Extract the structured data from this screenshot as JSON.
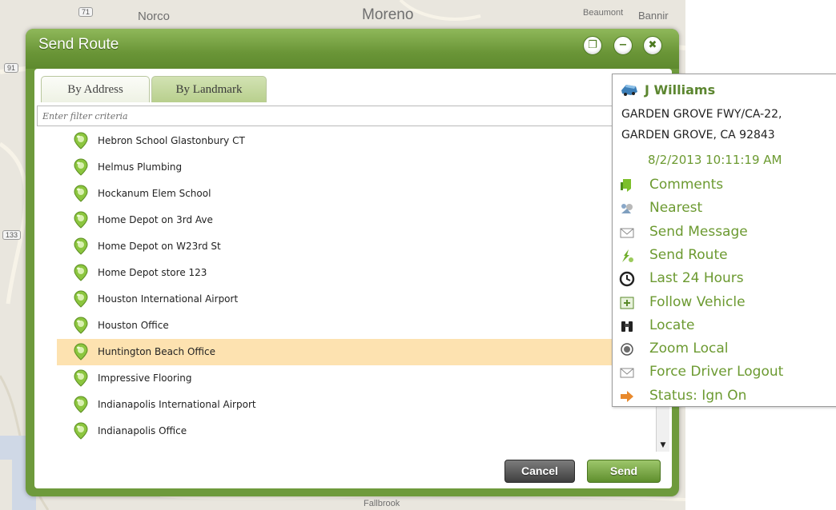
{
  "map": {
    "labels": [
      "Norco",
      "Moreno",
      "Beaumont",
      "Bannir",
      "Fallbrook"
    ],
    "shields": [
      "71",
      "91",
      "133"
    ]
  },
  "dialog": {
    "title": "Send Route",
    "tabs": [
      {
        "label": "By Address",
        "active": false
      },
      {
        "label": "By Landmark",
        "active": true
      }
    ],
    "filter": {
      "placeholder": "Enter filter criteria",
      "value": ""
    },
    "landmarks": [
      {
        "label": "Hebron School Glastonbury CT",
        "selected": false
      },
      {
        "label": "Helmus Plumbing",
        "selected": false
      },
      {
        "label": "Hockanum Elem School",
        "selected": false
      },
      {
        "label": "Home Depot on 3rd Ave",
        "selected": false
      },
      {
        "label": "Home Depot on W23rd St",
        "selected": false
      },
      {
        "label": "Home Depot store 123",
        "selected": false
      },
      {
        "label": "Houston International Airport",
        "selected": false
      },
      {
        "label": "Houston Office",
        "selected": false
      },
      {
        "label": "Huntington Beach Office",
        "selected": true
      },
      {
        "label": "Impressive Flooring",
        "selected": false
      },
      {
        "label": "Indianapolis International Airport",
        "selected": false
      },
      {
        "label": "Indianapolis Office",
        "selected": false
      }
    ],
    "buttons": {
      "cancel": "Cancel",
      "send": "Send"
    }
  },
  "popup": {
    "driver": "J Williams",
    "address_line1": "GARDEN GROVE FWY/CA-22,",
    "address_line2": "GARDEN GROVE, CA 92843",
    "timestamp": "8/2/2013 10:11:19 AM",
    "menu": [
      {
        "label": "Comments",
        "icon": "comments-icon"
      },
      {
        "label": "Nearest",
        "icon": "nearest-icon"
      },
      {
        "label": "Send Message",
        "icon": "envelope-icon"
      },
      {
        "label": "Send Route",
        "icon": "route-icon"
      },
      {
        "label": "Last 24 Hours",
        "icon": "clock-icon"
      },
      {
        "label": "Follow Vehicle",
        "icon": "follow-icon"
      },
      {
        "label": "Locate",
        "icon": "binoculars-icon"
      },
      {
        "label": "Zoom Local",
        "icon": "zoom-icon"
      },
      {
        "label": "Force Driver Logout",
        "icon": "envelope-icon"
      },
      {
        "label": "Status: Ign On",
        "icon": "arrow-right-icon"
      }
    ]
  }
}
